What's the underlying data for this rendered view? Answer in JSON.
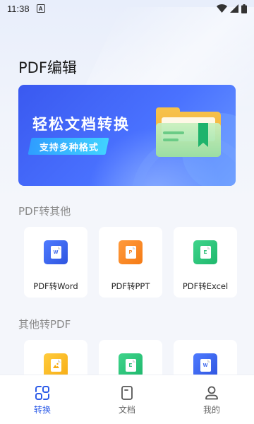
{
  "status_bar": {
    "time": "11:38",
    "notification_letter": "A"
  },
  "page": {
    "title": "PDF编辑"
  },
  "banner": {
    "headline": "轻松文档转换",
    "tagline": "支持多种格式"
  },
  "sections": [
    {
      "title": "PDF转其他",
      "cards": [
        {
          "label": "PDF转Word",
          "icon": "word-file-icon",
          "glyph": "W"
        },
        {
          "label": "PDF转PPT",
          "icon": "ppt-file-icon",
          "glyph": "P"
        },
        {
          "label": "PDF转Excel",
          "icon": "excel-file-icon",
          "glyph": "E"
        }
      ]
    },
    {
      "title": "其他转PDF",
      "cards": [
        {
          "label": "",
          "icon": "image-file-icon",
          "glyph": ""
        },
        {
          "label": "",
          "icon": "excel-file-icon",
          "glyph": "E"
        },
        {
          "label": "",
          "icon": "word-file-icon",
          "glyph": "W"
        }
      ]
    }
  ],
  "tabbar": {
    "items": [
      {
        "label": "转换",
        "icon": "convert-icon",
        "active": true
      },
      {
        "label": "文档",
        "icon": "document-icon",
        "active": false
      },
      {
        "label": "我的",
        "icon": "profile-icon",
        "active": false
      }
    ]
  },
  "colors": {
    "accent": "#2c5be8",
    "word": "#2f55e0",
    "ppt": "#f57b15",
    "excel": "#1fb86d",
    "image": "#f7ad15"
  }
}
